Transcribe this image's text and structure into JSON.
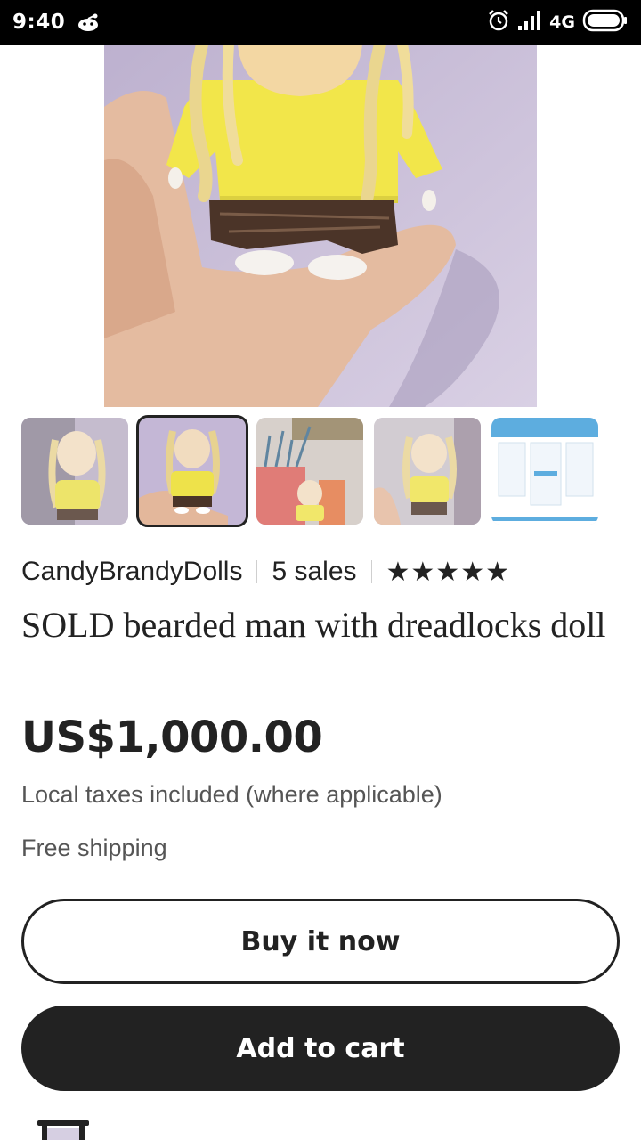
{
  "status_bar": {
    "time": "9:40",
    "network": "4G",
    "icons": [
      "reddit-icon",
      "alarm-icon",
      "signal-icon",
      "battery-icon"
    ]
  },
  "gallery": {
    "thumbnails": [
      {
        "name": "doll-front-purple-bg"
      },
      {
        "name": "doll-in-hand",
        "selected": true
      },
      {
        "name": "doll-with-pencils"
      },
      {
        "name": "doll-in-hand-alt"
      },
      {
        "name": "paypal-info-screenshot"
      }
    ]
  },
  "seller": {
    "name": "CandyBrandyDolls",
    "sales": "5 sales",
    "rating": "★★★★★"
  },
  "listing": {
    "title": "SOLD bearded man with dreadlocks doll",
    "price": "US$1,000.00",
    "tax_note": "Local taxes included (where applicable)",
    "shipping": "Free shipping"
  },
  "actions": {
    "buy_now": "Buy it now",
    "add_to_cart": "Add to cart"
  },
  "colors": {
    "text": "#222222",
    "muted": "#555555",
    "button_dark": "#222222",
    "doll_shirt": "#f2e64a"
  }
}
